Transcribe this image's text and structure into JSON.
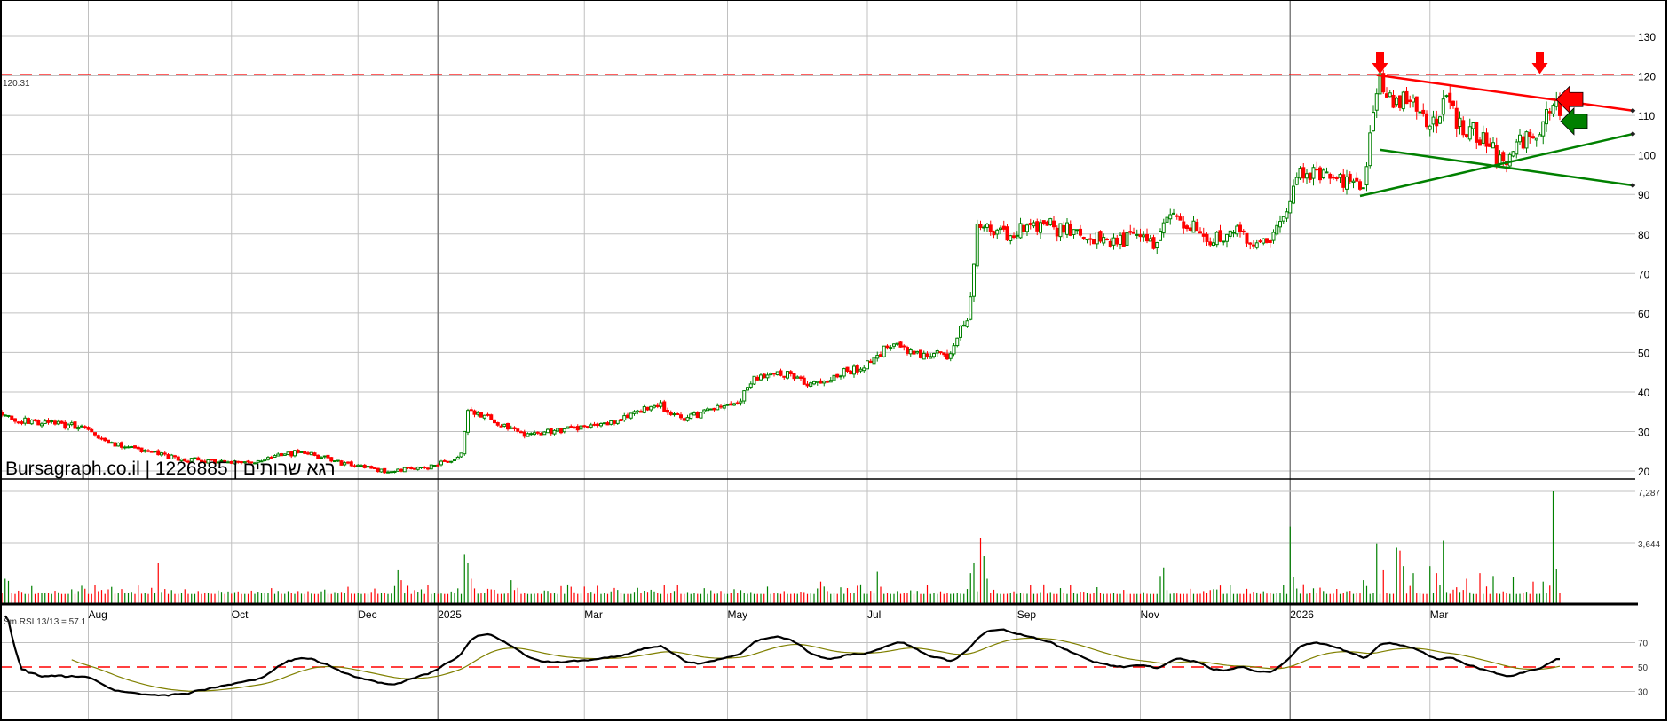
{
  "chart_data": {
    "type": "candlestick",
    "title": "Bursagraph.co.il | 1226885 | רגא שרותים",
    "price_axis": {
      "ylim": [
        15,
        135
      ],
      "ticks": [
        20,
        30,
        40,
        50,
        60,
        70,
        80,
        90,
        100,
        110,
        120,
        130
      ]
    },
    "resistance_level": {
      "value": 120.31,
      "label": "120.31"
    },
    "close_path_keypoints": [
      [
        0,
        35
      ],
      [
        3,
        33
      ],
      [
        26,
        31
      ],
      [
        32,
        27
      ],
      [
        54,
        23
      ],
      [
        74,
        22
      ],
      [
        90,
        25
      ],
      [
        102,
        22
      ],
      [
        115,
        20
      ],
      [
        128,
        21
      ],
      [
        136,
        23
      ],
      [
        138,
        24
      ],
      [
        140,
        36
      ],
      [
        150,
        32
      ],
      [
        157,
        29
      ],
      [
        173,
        31
      ],
      [
        186,
        33
      ],
      [
        197,
        37
      ],
      [
        205,
        33
      ],
      [
        214,
        36
      ],
      [
        221,
        37
      ],
      [
        226,
        44
      ],
      [
        234,
        45
      ],
      [
        243,
        42
      ],
      [
        253,
        45
      ],
      [
        261,
        47
      ],
      [
        266,
        52
      ],
      [
        275,
        50
      ],
      [
        285,
        49
      ],
      [
        287,
        55
      ],
      [
        290,
        59
      ],
      [
        291,
        65
      ],
      [
        293,
        81
      ],
      [
        301,
        80
      ],
      [
        314,
        82
      ],
      [
        330,
        79
      ],
      [
        346,
        78
      ],
      [
        352,
        85
      ],
      [
        362,
        79
      ],
      [
        371,
        80
      ],
      [
        381,
        78
      ],
      [
        384,
        82
      ],
      [
        387,
        87
      ],
      [
        389,
        96
      ],
      [
        394,
        95
      ],
      [
        403,
        93
      ],
      [
        409,
        91
      ],
      [
        411,
        105
      ],
      [
        413,
        115
      ],
      [
        414,
        119
      ],
      [
        418,
        112
      ],
      [
        422,
        114
      ],
      [
        429,
        107
      ],
      [
        434,
        114
      ],
      [
        438,
        108
      ],
      [
        445,
        104
      ],
      [
        450,
        99
      ],
      [
        453,
        98
      ],
      [
        456,
        104
      ],
      [
        461,
        104
      ],
      [
        463,
        108
      ],
      [
        466,
        113
      ],
      [
        468,
        111
      ]
    ],
    "noise_seed": 7,
    "x_axis": {
      "labels": [
        {
          "label": "Aug",
          "day": 26
        },
        {
          "label": "Oct",
          "day": 69
        },
        {
          "label": "Dec",
          "day": 107
        },
        {
          "label": "2025",
          "day": 131,
          "major": true
        },
        {
          "label": "Mar",
          "day": 175
        },
        {
          "label": "May",
          "day": 218
        },
        {
          "label": "Jul",
          "day": 260
        },
        {
          "label": "Sep",
          "day": 305
        },
        {
          "label": "Nov",
          "day": 342
        },
        {
          "label": "2026",
          "day": 387,
          "major": true
        },
        {
          "label": "Mar",
          "day": 429
        }
      ]
    },
    "volume": {
      "ticks": [
        {
          "value": 7287,
          "label": "7,287"
        },
        {
          "value": 3644,
          "label": "3,644"
        }
      ],
      "spikes": [
        [
          1,
          1100
        ],
        [
          2,
          950
        ],
        [
          47,
          2200
        ],
        [
          119,
          1700
        ],
        [
          120,
          1000
        ],
        [
          139,
          2800
        ],
        [
          140,
          2200
        ],
        [
          141,
          1100
        ],
        [
          153,
          1000
        ],
        [
          246,
          900
        ],
        [
          263,
          1600
        ],
        [
          291,
          1500
        ],
        [
          292,
          2200
        ],
        [
          294,
          4000
        ],
        [
          295,
          2700
        ],
        [
          296,
          1100
        ],
        [
          348,
          1300
        ],
        [
          349,
          1900
        ],
        [
          387,
          4800
        ],
        [
          388,
          1200
        ],
        [
          409,
          1000
        ],
        [
          413,
          3600
        ],
        [
          415,
          1700
        ],
        [
          419,
          3300
        ],
        [
          420,
          3100
        ],
        [
          421,
          2000
        ],
        [
          424,
          1500
        ],
        [
          429,
          2000
        ],
        [
          431,
          1500
        ],
        [
          433,
          3800
        ],
        [
          440,
          1100
        ],
        [
          444,
          1500
        ],
        [
          448,
          1300
        ],
        [
          454,
          1200
        ],
        [
          460,
          900
        ],
        [
          463,
          900
        ],
        [
          466,
          7287
        ],
        [
          467,
          1800
        ]
      ]
    },
    "indicator": {
      "name": "Sm.RSI 13/13",
      "label": "Sm.RSI 13/13 = 57.1",
      "value": 57.1,
      "ticks": [
        70,
        50,
        30
      ],
      "reference_level": 50
    },
    "annotations": {
      "down_arrows": [
        {
          "day": 414,
          "price": 120
        },
        {
          "day": 462,
          "price": 120
        }
      ],
      "trendlines": [
        {
          "color": "#ff0000",
          "from": [
            413,
            120.2
          ],
          "to": [
            491,
            111.2
          ]
        },
        {
          "color": "#008000",
          "from": [
            408,
            89.6
          ],
          "to": [
            491,
            105.3
          ]
        },
        {
          "color": "#008000",
          "from": [
            414,
            101.3
          ],
          "to": [
            491,
            92.3
          ]
        }
      ],
      "signal_arrows": [
        {
          "color": "#ff0000",
          "direction": "left",
          "price": 114
        },
        {
          "color": "#008000",
          "direction": "left",
          "price": 108.5
        }
      ]
    }
  },
  "colors": {
    "up": "#008000",
    "down": "#ff0000",
    "grid": "#c0c0c0",
    "rsi": "#000000",
    "rsi_ma": "#808000"
  }
}
